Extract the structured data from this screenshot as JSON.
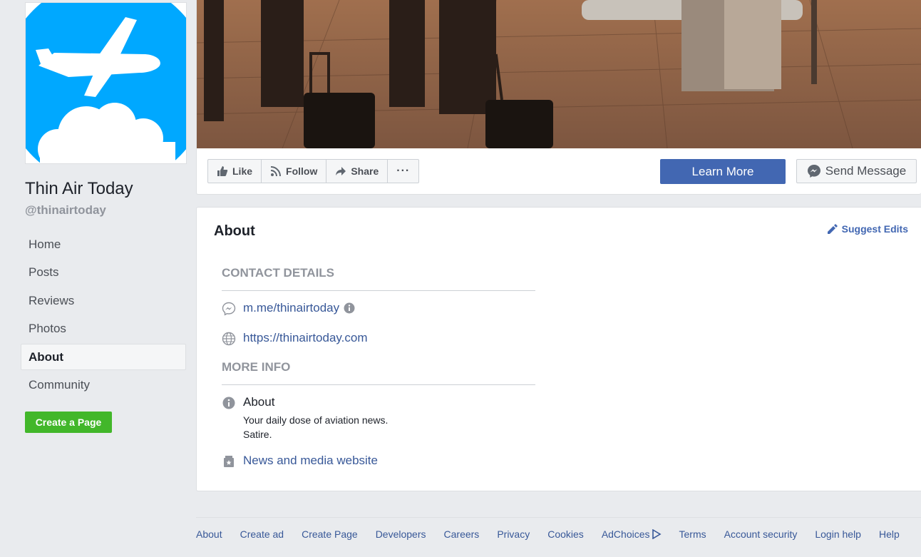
{
  "page": {
    "name": "Thin Air Today",
    "handle": "@thinairtoday"
  },
  "nav": {
    "items": [
      {
        "label": "Home"
      },
      {
        "label": "Posts"
      },
      {
        "label": "Reviews"
      },
      {
        "label": "Photos"
      },
      {
        "label": "About",
        "active": true
      },
      {
        "label": "Community"
      }
    ],
    "create_page": "Create a Page"
  },
  "actions": {
    "like": "Like",
    "follow": "Follow",
    "share": "Share",
    "more": "···",
    "learn_more": "Learn More",
    "send_message": "Send Message"
  },
  "about": {
    "title": "About",
    "suggest_edits": "Suggest Edits",
    "contact_heading": "CONTACT DETAILS",
    "messenger": "m.me/thinairtoday",
    "website": "https://thinairtoday.com",
    "more_info_heading": "MORE INFO",
    "about_label": "About",
    "about_line1": "Your daily dose of aviation news.",
    "about_line2": "Satire.",
    "category": "News and media website"
  },
  "footer": {
    "links": [
      "About",
      "Create ad",
      "Create Page",
      "Developers",
      "Careers",
      "Privacy",
      "Cookies",
      "AdChoices",
      "Terms",
      "Account security",
      "Login help",
      "Help"
    ]
  },
  "colors": {
    "brand_blue": "#4267b2",
    "link_blue": "#385898",
    "create_green": "#42b72a",
    "avatar_blue": "#00a8ff"
  }
}
